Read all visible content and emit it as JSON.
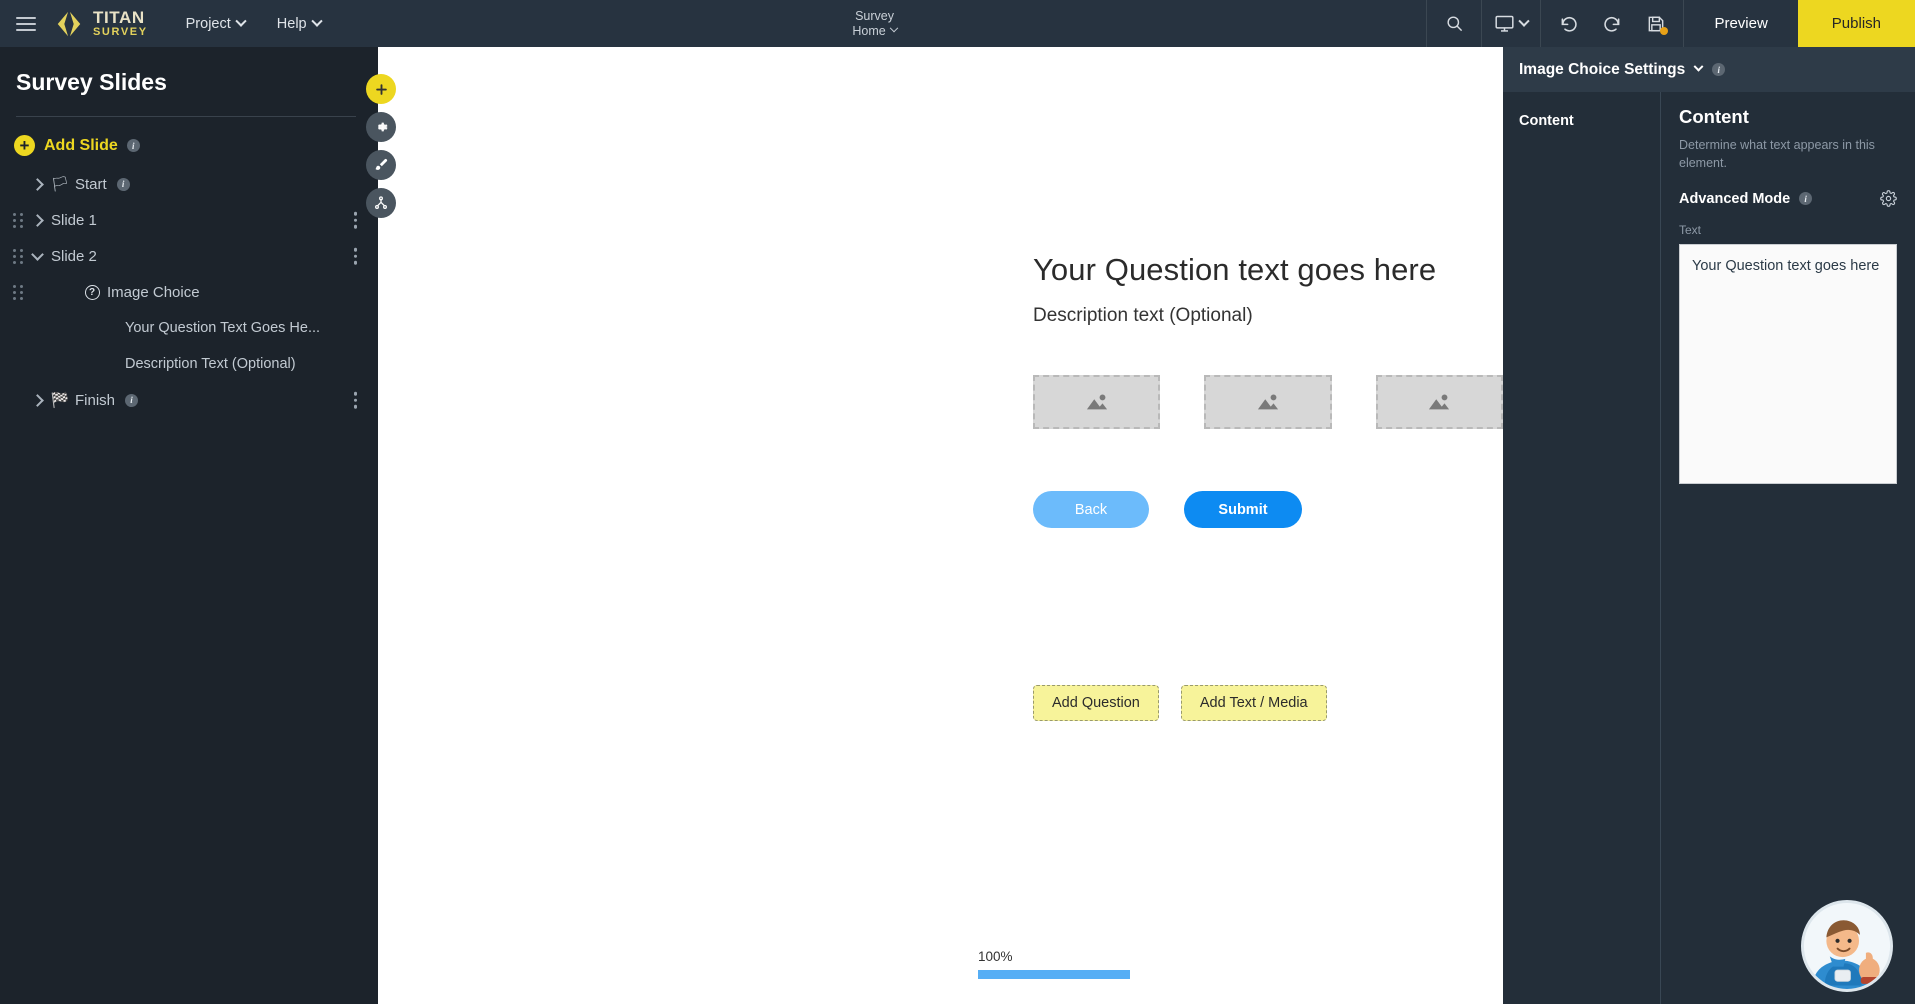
{
  "topbar": {
    "menu_icon": "hamburger-icon",
    "brand": {
      "title": "TITAN",
      "subtitle": "SURVEY"
    },
    "menu": [
      {
        "label": "Project",
        "icon": "chevron-down-icon"
      },
      {
        "label": "Help",
        "icon": "chevron-down-icon"
      }
    ],
    "center": {
      "title": "Survey",
      "subtitle": "Home"
    },
    "icons": [
      {
        "name": "search-icon"
      },
      {
        "name": "device-preview-icon"
      },
      {
        "name": "undo-icon"
      },
      {
        "name": "redo-icon"
      },
      {
        "name": "save-icon"
      }
    ],
    "preview_label": "Preview",
    "publish_label": "Publish"
  },
  "sidebar": {
    "title": "Survey Slides",
    "add_slide_label": "Add Slide",
    "info_char": "i",
    "fabs": [
      {
        "name": "add-element-fab",
        "glyph": "+"
      },
      {
        "name": "settings-fab",
        "glyph": "gear"
      },
      {
        "name": "theme-brush-fab",
        "glyph": "brush"
      },
      {
        "name": "flow-logic-fab",
        "glyph": "nodes"
      }
    ],
    "tree": [
      {
        "id": "start",
        "label": "Start",
        "icon": "flag-icon",
        "glyph": "🏳",
        "arrow": "right",
        "indent": 1,
        "drag": false,
        "info": true,
        "kebab": false
      },
      {
        "id": "slide-1",
        "label": "Slide 1",
        "icon": "",
        "glyph": "",
        "arrow": "right",
        "indent": 1,
        "drag": true,
        "info": false,
        "kebab": true
      },
      {
        "id": "slide-2",
        "label": "Slide 2",
        "icon": "",
        "glyph": "",
        "arrow": "down",
        "indent": 1,
        "drag": true,
        "info": false,
        "kebab": true
      },
      {
        "id": "image-choice",
        "label": "Image Choice",
        "icon": "question-circle-icon",
        "glyph": "?",
        "arrow": "",
        "indent": 2,
        "drag": true,
        "info": false,
        "kebab": false
      },
      {
        "id": "question-text",
        "label": "Your Question Text Goes He...",
        "icon": "",
        "glyph": "",
        "arrow": "",
        "indent": 3,
        "drag": false,
        "info": false,
        "kebab": false
      },
      {
        "id": "description-text",
        "label": "Description Text (Optional)",
        "icon": "",
        "glyph": "",
        "arrow": "",
        "indent": 3,
        "drag": false,
        "info": false,
        "kebab": false
      },
      {
        "id": "finish",
        "label": "Finish",
        "icon": "checkered-flag-icon",
        "glyph": "🏁",
        "arrow": "right",
        "indent": 1,
        "drag": false,
        "info": true,
        "kebab": true
      }
    ]
  },
  "canvas": {
    "question_title": "Your Question text goes here",
    "question_description": "Description text (Optional)",
    "choices": [
      {
        "name": "image-choice-1",
        "icon": "image-placeholder-icon"
      },
      {
        "name": "image-choice-2",
        "icon": "image-placeholder-icon"
      },
      {
        "name": "image-choice-3",
        "icon": "image-placeholder-icon"
      }
    ],
    "back_label": "Back",
    "submit_label": "Submit",
    "add_question_label": "Add Question",
    "add_text_media_label": "Add Text / Media",
    "zoom_percent": "100%",
    "zoom_value": 100,
    "collapse_icon": "chevron-up-icon"
  },
  "right_panel": {
    "header_title": "Image Choice Settings",
    "header_chevron": "chevron-down-icon",
    "info_char": "i",
    "tabs": [
      {
        "label": "Content",
        "active": true
      }
    ],
    "content_heading": "Content",
    "content_description": "Determine what text appears in this element.",
    "advanced_mode_label": "Advanced Mode",
    "gear_icon": "gear-icon",
    "text_field_label": "Text",
    "text_field_value": "Your Question text goes here"
  },
  "support": {
    "avatar": "support-mascot-avatar"
  },
  "colors": {
    "topbar_bg": "#273340",
    "publish_yellow": "#edd720",
    "sidebar_bg": "#1c232b",
    "panel_bg": "#232e39",
    "accent_blue": "#0d8bf2",
    "light_blue": "#6cbbfb",
    "add_button_yellow": "#f7f39a"
  }
}
